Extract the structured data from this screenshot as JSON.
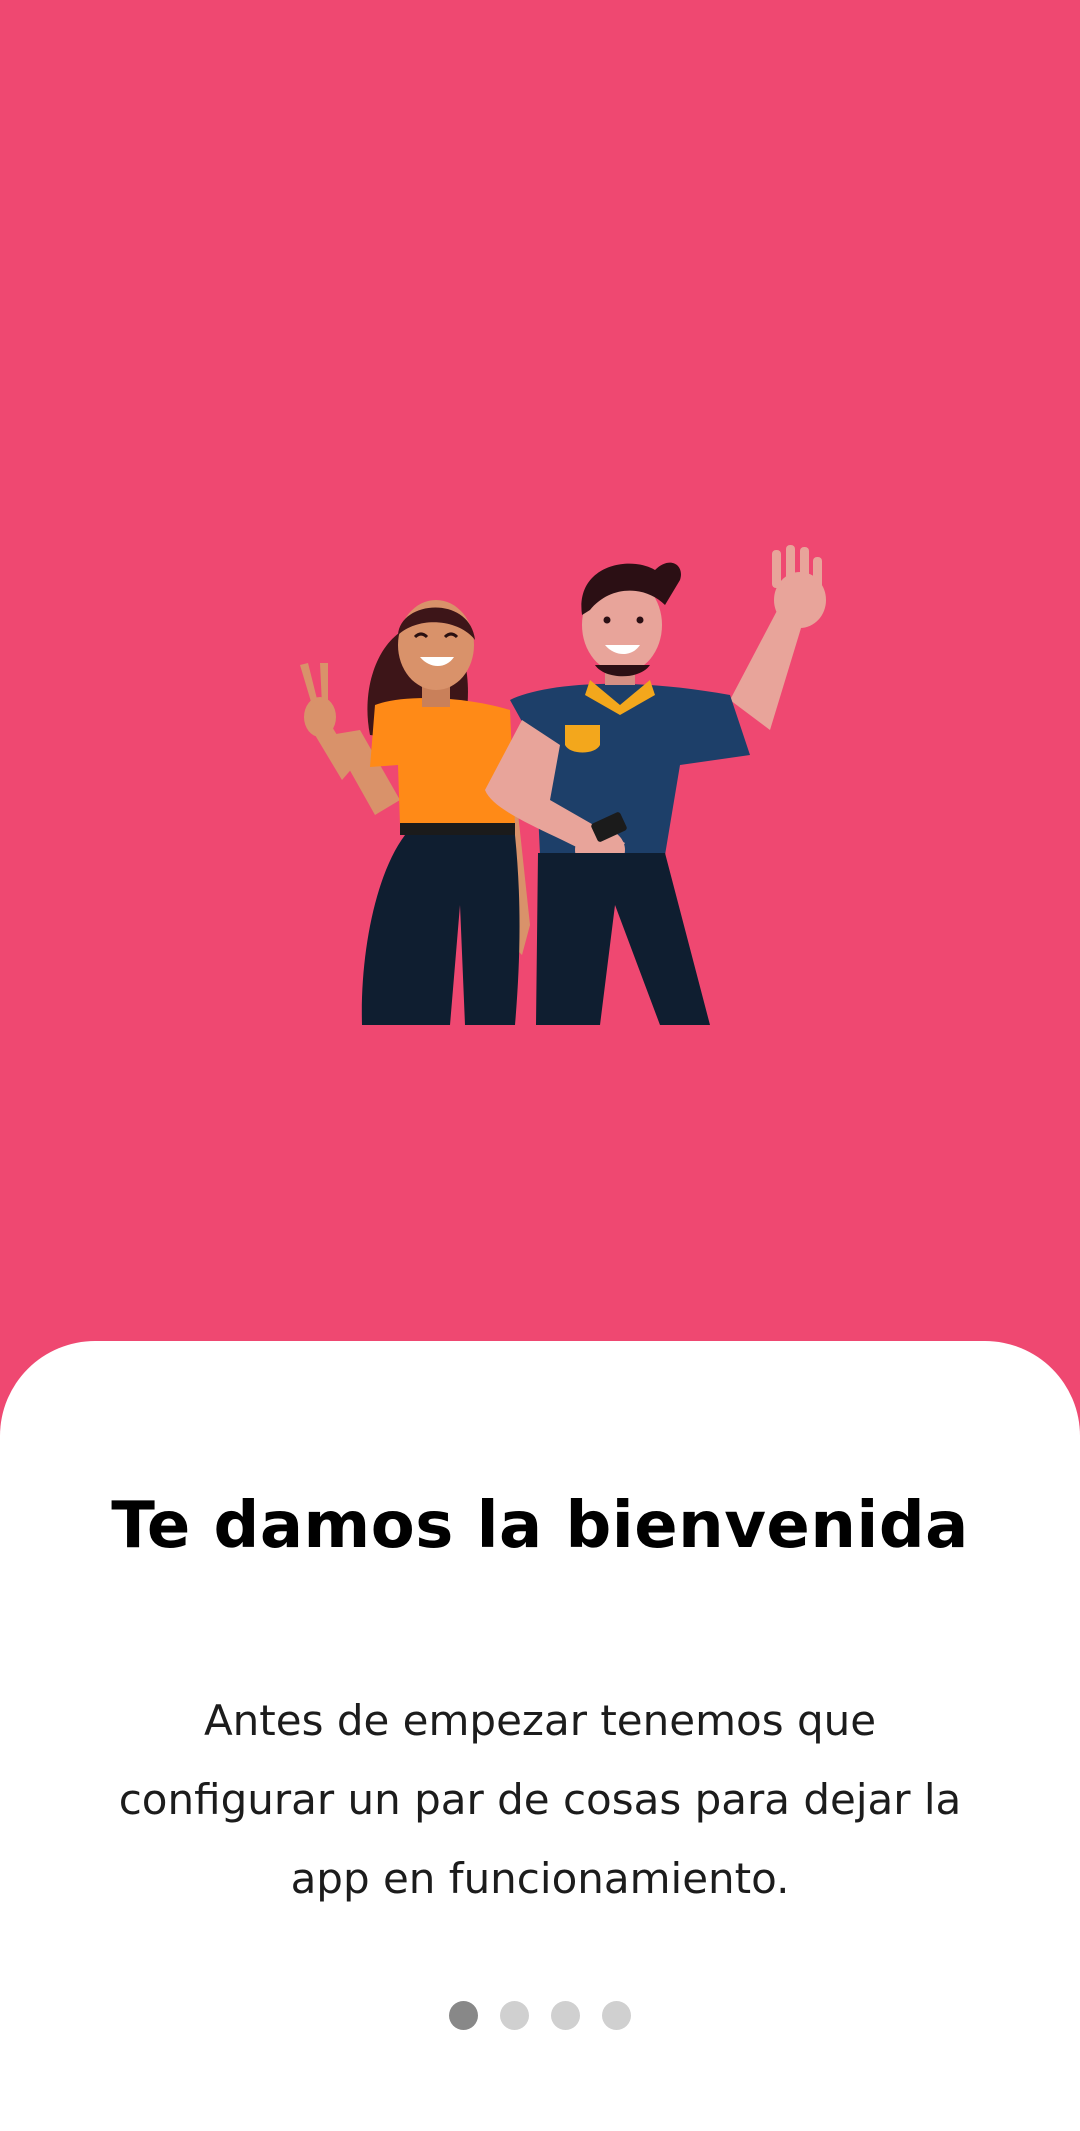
{
  "colors": {
    "background": "#ef4871",
    "card": "#ffffff",
    "dot_active": "#888888",
    "dot_inactive": "#d0d0d0"
  },
  "illustration": {
    "icon": "two-people-waving-illustration"
  },
  "onboarding": {
    "title": "Te damos la bienvenida",
    "description": "Antes de empezar tenemos que configurar un par de cosas para dejar la app en funcionamiento."
  },
  "pager": {
    "total_pages": 4,
    "current_page": 1
  }
}
